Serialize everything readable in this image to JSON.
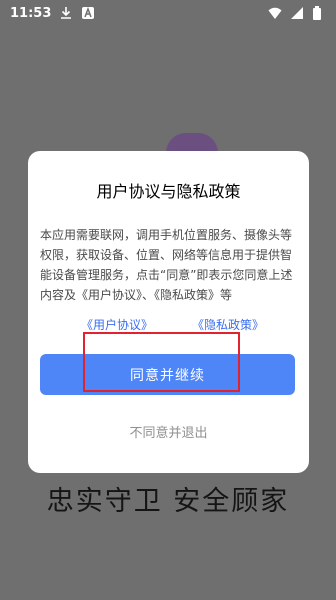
{
  "status_bar": {
    "time": "11:53",
    "left_icons": [
      "download-icon",
      "generic-a-icon"
    ],
    "right_icons": [
      "wifi-icon",
      "signal-icon",
      "battery-icon"
    ],
    "text_color": "#ffffff"
  },
  "background": {
    "slogan": "忠实守卫 安全顾家"
  },
  "dialog": {
    "title": "用户协议与隐私政策",
    "body": "本应用需要联网，调用手机位置服务、摄像头等权限，获取设备、位置、网络等信息用于提供智能设备管理服务，点击“同意”即表示您同意上述内容及《用户协议》、《隐私政策》等",
    "links": {
      "user_agreement": "《用户协议》",
      "privacy_policy": "《隐私政策》",
      "color": "#3a6ef0"
    },
    "agree_button": "同意并继续",
    "agree_button_color": "#4f86f7",
    "disagree_button": "不同意并退出",
    "highlight_color": "#e0232e"
  }
}
